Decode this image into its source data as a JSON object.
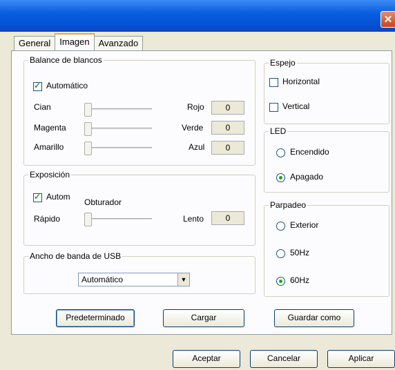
{
  "window": {
    "close_glyph": "✕"
  },
  "tabs": [
    "General",
    "Imagen",
    "Avanzado"
  ],
  "white_balance": {
    "legend": "Balance de blancos",
    "auto_label": "Automático",
    "auto_checked": true,
    "rows": [
      {
        "left": "Cian",
        "right": "Rojo",
        "value": "0"
      },
      {
        "left": "Magenta",
        "right": "Verde",
        "value": "0"
      },
      {
        "left": "Amarillo",
        "right": "Azul",
        "value": "0"
      }
    ]
  },
  "exposure": {
    "legend": "Exposición",
    "auto_label": "Autom",
    "auto_checked": true,
    "shutter_label": "Obturador",
    "left": "Rápido",
    "right": "Lento",
    "value": "0"
  },
  "usb": {
    "legend": "Ancho de banda de USB",
    "selected": "Automático"
  },
  "mirror": {
    "legend": "Espejo",
    "horizontal": "Horizontal",
    "vertical": "Vertical"
  },
  "led": {
    "legend": "LED",
    "on": "Encendido",
    "off": "Apagado",
    "selected": "off"
  },
  "flicker": {
    "legend": "Parpadeo",
    "outdoor": "Exterior",
    "hz50": "50Hz",
    "hz60": "60Hz",
    "selected": "60Hz"
  },
  "panel_buttons": {
    "default": "Predeterminado",
    "load": "Cargar",
    "save_as": "Guardar como"
  },
  "dialog_buttons": {
    "ok": "Aceptar",
    "cancel": "Cancelar",
    "apply": "Aplicar"
  }
}
